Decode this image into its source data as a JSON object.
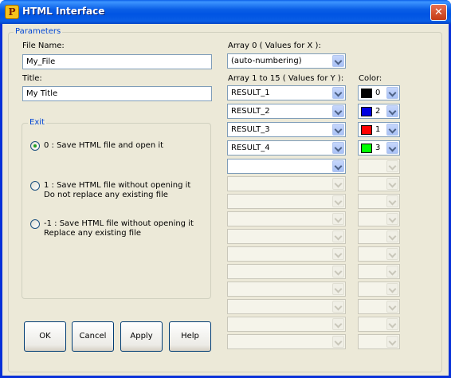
{
  "window": {
    "title": "HTML Interface",
    "close_glyph": "✕",
    "icon_glyph": "P"
  },
  "parameters": {
    "legend": "Parameters",
    "file_name_label": "File Name:",
    "file_name_value": "My_File",
    "title_label": "Title:",
    "title_value": "My Title",
    "array0_label": "Array 0 ( Values for X ):",
    "array0_value": "(auto-numbering)",
    "array1_label": "Array 1 to 15 ( Values for Y ):",
    "color_label": "Color:",
    "arrays": [
      {
        "value": "RESULT_1",
        "color": "#000000",
        "color_index": "0"
      },
      {
        "value": "RESULT_2",
        "color": "#0000e0",
        "color_index": "2"
      },
      {
        "value": "RESULT_3",
        "color": "#ff0000",
        "color_index": "1"
      },
      {
        "value": "RESULT_4",
        "color": "#00ff00",
        "color_index": "3"
      }
    ]
  },
  "exit": {
    "legend": "Exit",
    "options": [
      {
        "line1": "0 : Save HTML file and open it",
        "line2": "",
        "checked": true
      },
      {
        "line1": "1 : Save HTML file without opening it",
        "line2": "Do not replace any existing file",
        "checked": false
      },
      {
        "line1": "-1 : Save HTML file without opening it",
        "line2": "Replace any existing file",
        "checked": false
      }
    ]
  },
  "buttons": {
    "ok": "OK",
    "cancel": "Cancel",
    "apply": "Apply",
    "help": "Help"
  }
}
